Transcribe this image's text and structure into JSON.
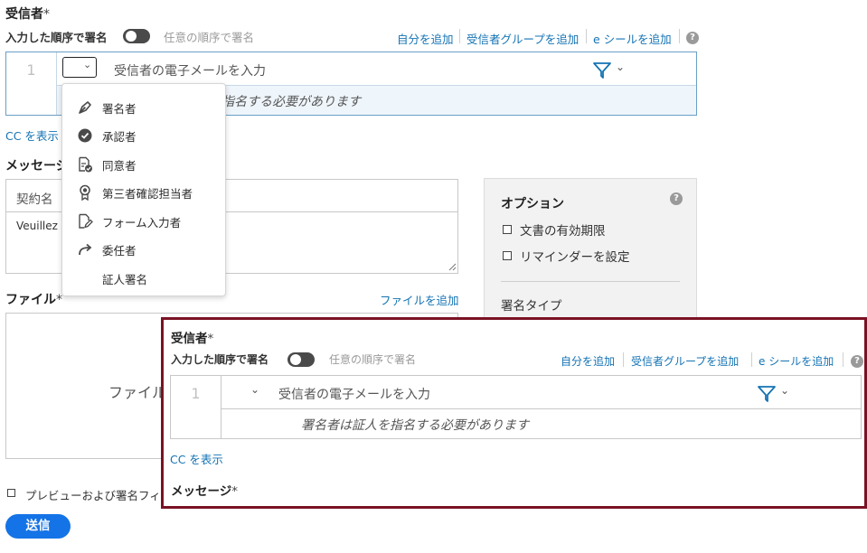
{
  "recipients": {
    "title": "受信者",
    "required_mark": "*",
    "sign_in_order": "入力した順序で署名",
    "any_order": "任意の順序で署名",
    "add_me": "自分を追加",
    "add_group": "受信者グループを追加",
    "add_eseal": "e シールを追加",
    "help": "?",
    "row_number": "1",
    "email_placeholder": "受信者の電子メールを入力",
    "notary_warning": "署名者は証人を指名する必要があります",
    "notary_warning_partial": "指名する必要があります",
    "show_cc": "CC を表示"
  },
  "role_menu": {
    "items": [
      {
        "label": "署名者",
        "icon": "pen-icon"
      },
      {
        "label": "承認者",
        "icon": "check-circle-icon"
      },
      {
        "label": "同意者",
        "icon": "document-check-icon"
      },
      {
        "label": "第三者確認担当者",
        "icon": "ribbon-icon"
      },
      {
        "label": "フォーム入力者",
        "icon": "form-edit-icon"
      },
      {
        "label": "委任者",
        "icon": "forward-arrow-icon"
      },
      {
        "label": "証人署名",
        "icon": ""
      }
    ]
  },
  "message": {
    "title": "メッセージ",
    "title_partial": "メッセージ",
    "required_mark": "*",
    "agreement_name_placeholder": "契約名",
    "body_partial": "Veuillez r"
  },
  "files": {
    "title": "ファイル",
    "required_mark": "*",
    "add_files": "ファイルを追加",
    "drop_partial": "ファイル"
  },
  "options": {
    "title": "オプション",
    "help": "?",
    "items": [
      "文書の有効期限",
      "リマインダーを設定"
    ],
    "signature_type": "署名タイプ"
  },
  "footer": {
    "preview_partial": "プレビューおよび署名フィ",
    "send": "送信"
  },
  "colors": {
    "link": "#1473b4",
    "send_button": "#1473e6",
    "highlight_border": "#7a1224",
    "recipient_border": "#6a9fc6",
    "recipient_bg": "#eef5fb"
  }
}
